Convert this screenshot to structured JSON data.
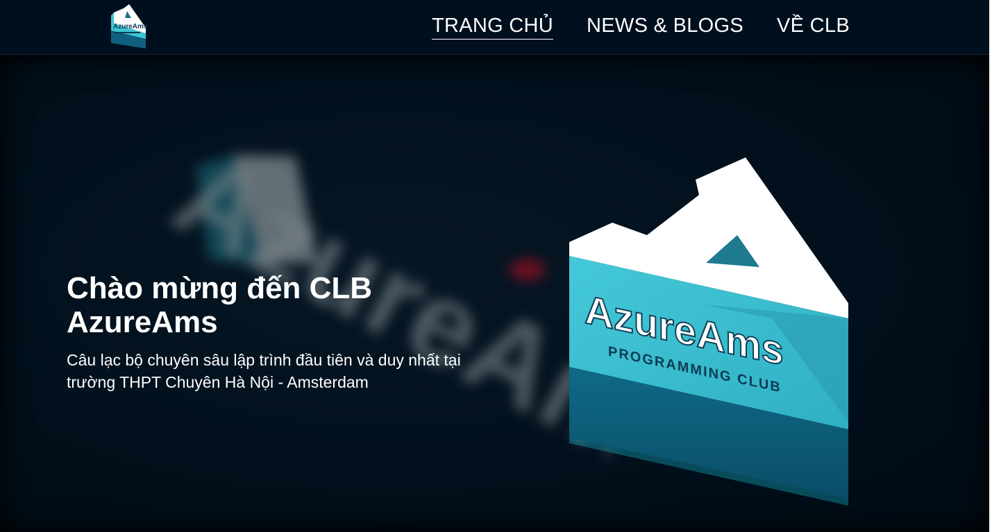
{
  "nav": {
    "brand_logo": "azureams-logo",
    "links": [
      {
        "label": "TRANG CHỦ",
        "active": true
      },
      {
        "label": "NEWS & BLOGS",
        "active": false
      },
      {
        "label": "VỀ CLB",
        "active": false
      }
    ]
  },
  "hero": {
    "title": "Chào mừng đến CLB AzureAms",
    "subtitle": "Câu lạc bộ chuyên sâu lập trình đầu tiên và duy nhất tại trường THPT Chuyên Hà Nội - Amsterdam",
    "logo": {
      "wordmark": "AzureAms",
      "tagline": "PROGRAMMING CLUB"
    },
    "background_text": "AzureAms"
  },
  "colors": {
    "background": "#000d18",
    "navbar": "#000f1d",
    "logo_cyan": "#45cfdc",
    "logo_teal": "#1c7f95",
    "logo_dark": "#0d5470",
    "text": "#ffffff"
  }
}
